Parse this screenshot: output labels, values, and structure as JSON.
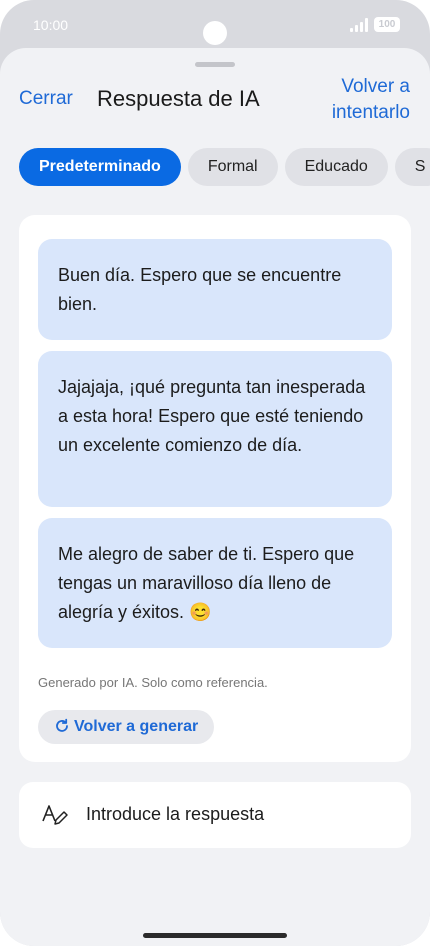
{
  "status": {
    "time": "10:00",
    "battery": "100"
  },
  "header": {
    "close_label": "Cerrar",
    "title": "Respuesta de IA",
    "retry_line1": "Volver a",
    "retry_line2": "intentarlo"
  },
  "tabs": [
    {
      "label": "Predeterminado",
      "active": true
    },
    {
      "label": "Formal"
    },
    {
      "label": "Educado"
    },
    {
      "label": "S"
    }
  ],
  "responses": [
    {
      "text": "Buen día. Espero que se encuentre bien."
    },
    {
      "text": "Jajajaja, ¡qué pregunta tan inesperada a esta hora! Espero que esté teniendo un excelente comienzo de día."
    },
    {
      "text": "Me alegro de saber de ti. Espero que tengas un maravilloso día lleno de alegría y éxitos. 😊"
    }
  ],
  "disclaimer": "Generado por IA. Solo como referencia.",
  "regenerate_label": "Volver a generar",
  "input": {
    "placeholder": "Introduce la respuesta"
  },
  "colors": {
    "accent": "#0a6ae3",
    "bubble": "#d9e6fb",
    "sheet": "#f1f2f5"
  }
}
